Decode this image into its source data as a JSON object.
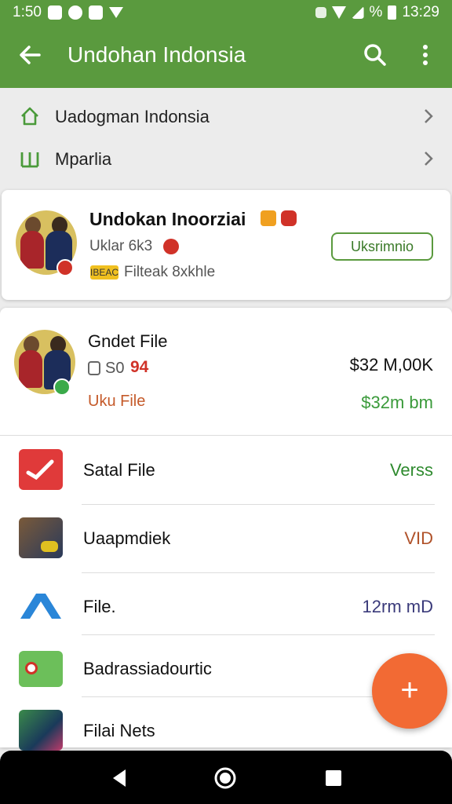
{
  "status_bar": {
    "time_left": "1:50",
    "battery": "%",
    "time_right": "13:29"
  },
  "app_bar": {
    "title": "Undohan Indonsia"
  },
  "breadcrumbs": [
    {
      "label": "Uadogman Indonsia",
      "icon": "home-icon"
    },
    {
      "label": "Mparlia",
      "icon": "columns-icon"
    }
  ],
  "profile_card": {
    "name": "Undokan Inoorziai",
    "subtitle": "Uklar 6k3",
    "tag": "IBEAC",
    "detail": "Filteak 8xkhle",
    "button_label": "Uksrimnio"
  },
  "file_card": {
    "title": "Gndet File",
    "stat_label": "S0",
    "stat_value": "94",
    "sub_label": "Uku File",
    "amount": "$32 M,00K",
    "amount_secondary": "$32m bm"
  },
  "file_rows": [
    {
      "label": "Satal File",
      "value": "Verss",
      "value_color": "#2e8a2e",
      "icon": "satal-app-icon"
    },
    {
      "label": "Uaapmdiek",
      "value": "VID",
      "value_color": "#b0522a",
      "icon": "photo-thumb-icon"
    },
    {
      "label": "File.",
      "value": "12rm mD",
      "value_color": "#3a3a7a",
      "icon": "blue-app-icon"
    },
    {
      "label": "Badrassiadourtic",
      "value": "",
      "value_color": "#333333",
      "icon": "green-app-icon"
    },
    {
      "label": "Filai Nets",
      "value": "",
      "value_color": "#333333",
      "icon": "image-thumb-icon"
    }
  ],
  "fab": {
    "label": "+"
  },
  "colors": {
    "primary": "#5a9a3e",
    "accent": "#f26a34",
    "danger": "#d03228"
  }
}
